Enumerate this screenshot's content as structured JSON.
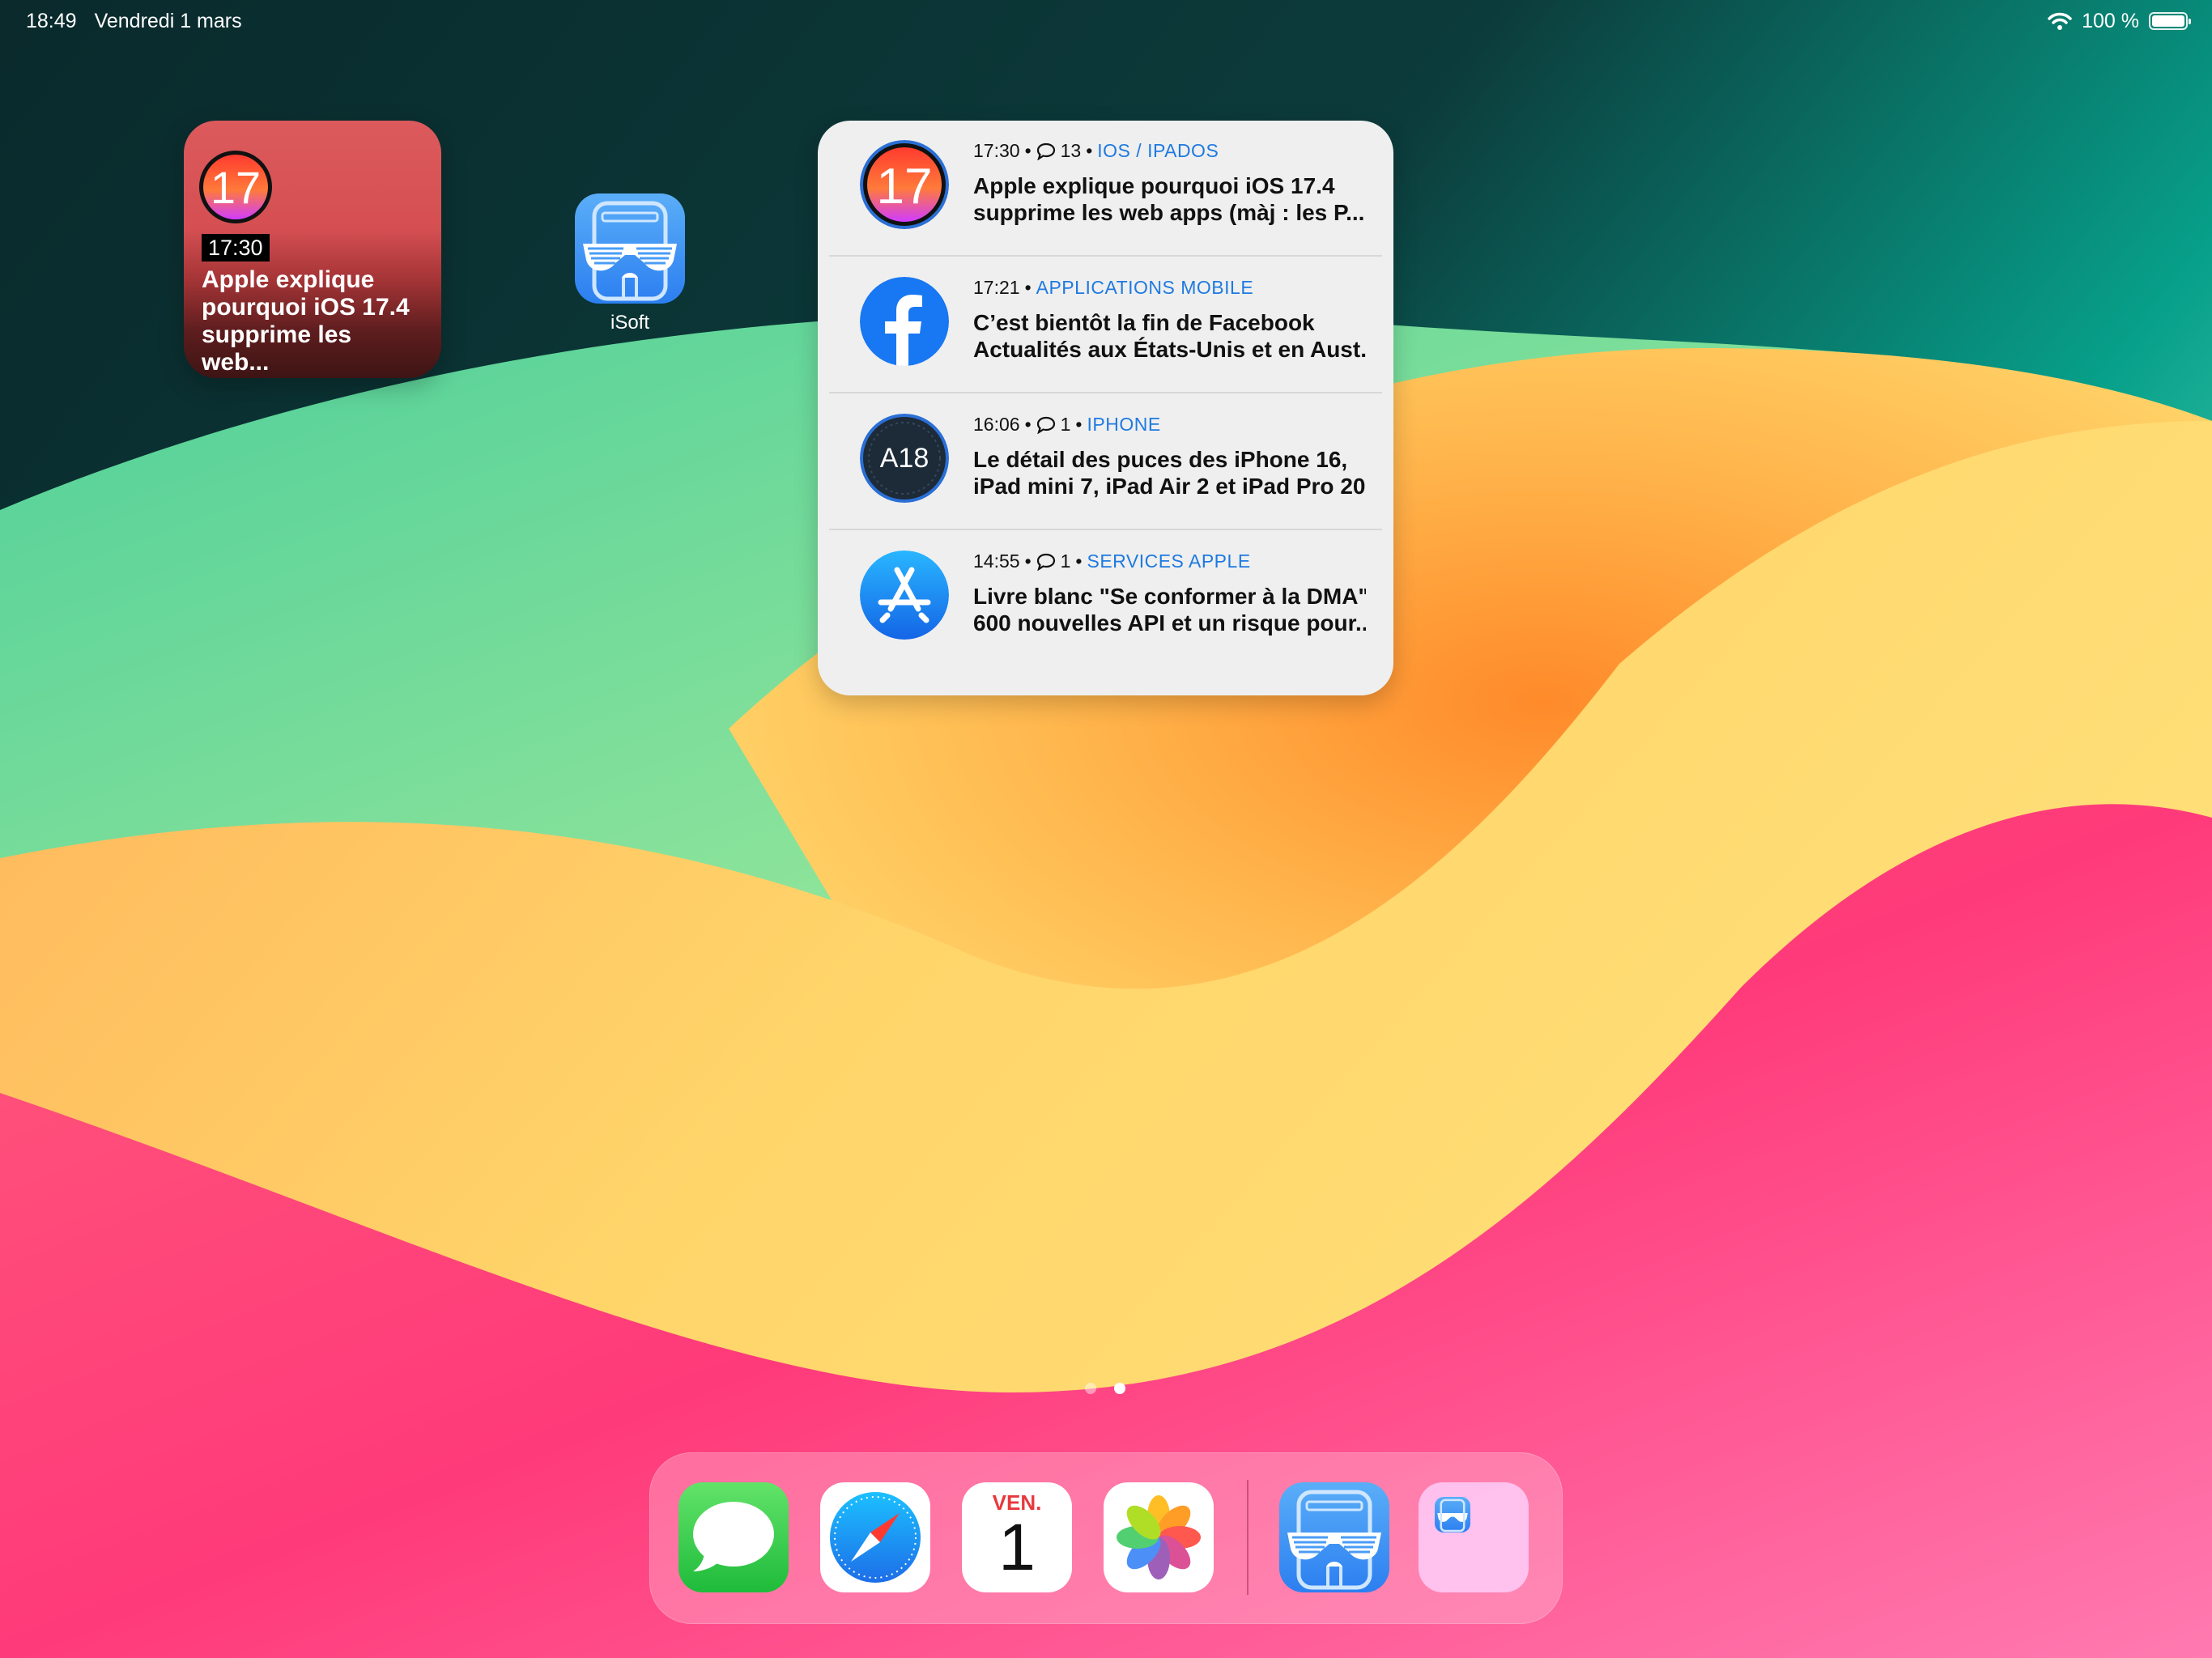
{
  "status_bar": {
    "time": "18:49",
    "date": "Vendredi 1 mars",
    "battery": "100 %"
  },
  "small_widget": {
    "badge": "17",
    "time": "17:30",
    "headline": "Apple explique pourquoi iOS 17.4 supprime les web..."
  },
  "home_apps": [
    {
      "name": "iSoft",
      "icon": "sunglasses-icon"
    }
  ],
  "news_widget": {
    "items": [
      {
        "icon": "ios17-icon",
        "thumb_text": "17",
        "time": "17:30",
        "comments": "13",
        "category": "IOS / IPADOS",
        "title_line1": "Apple explique pourquoi iOS 17.4",
        "title_line2": "supprime les web apps (màj : les P..."
      },
      {
        "icon": "facebook-icon",
        "thumb_text": "f",
        "time": "17:21",
        "comments": "",
        "category": "APPLICATIONS MOBILE",
        "title_line1": "C’est bientôt la fin de Facebook",
        "title_line2": "Actualités aux États-Unis et en Aust..."
      },
      {
        "icon": "a18-chip-icon",
        "thumb_text": "A18",
        "time": "16:06",
        "comments": "1",
        "category": "IPHONE",
        "title_line1": "Le détail des puces des iPhone 16,",
        "title_line2": "iPad mini 7, iPad Air 2 et iPad Pro 20..."
      },
      {
        "icon": "app-store-icon",
        "thumb_text": "",
        "time": "14:55",
        "comments": "1",
        "category": "SERVICES APPLE",
        "title_line1": "Livre blanc \"Se conformer à la DMA\" :",
        "title_line2": "600 nouvelles API et un risque pour..."
      }
    ]
  },
  "page_dots": {
    "count": 2,
    "active": 2
  },
  "dock": {
    "apps": [
      {
        "name": "Messages",
        "icon": "messages-icon"
      },
      {
        "name": "Safari",
        "icon": "safari-compass-icon"
      },
      {
        "name": "Calendrier",
        "icon": "calendar-icon",
        "day": "VEN.",
        "date": "1"
      },
      {
        "name": "Photos",
        "icon": "photos-flower-icon"
      },
      {
        "name": "iSoft",
        "icon": "sunglasses-icon"
      },
      {
        "name": "Dossier",
        "icon": "folder-icon"
      }
    ]
  }
}
